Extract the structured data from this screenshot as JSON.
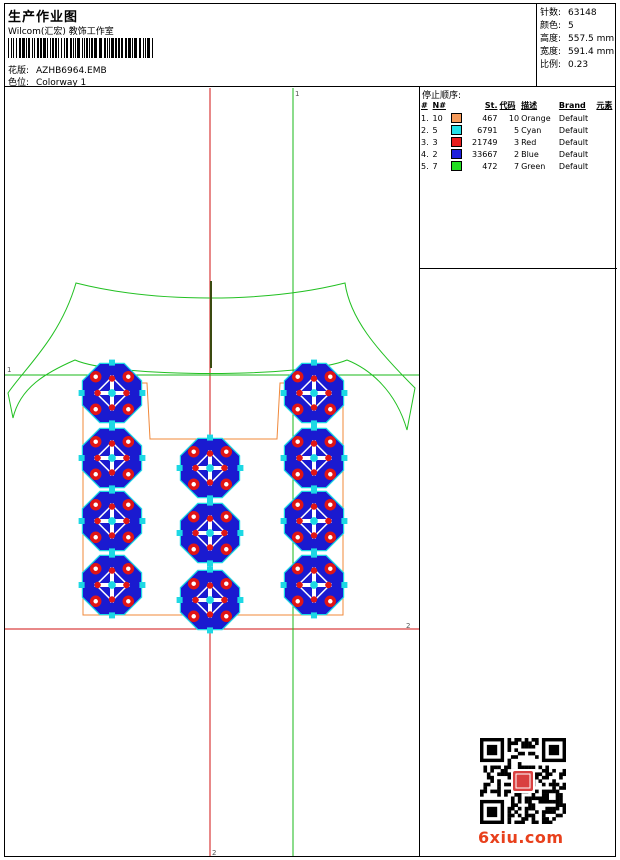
{
  "header": {
    "title": "生产作业图",
    "subtitle": "Wilcom(汇宏) 教饰工作室",
    "design_label": "花版:",
    "design_value": "AZHB6964.EMB",
    "colorway_label": "色位:",
    "colorway_value": "Colorway 1"
  },
  "stats": [
    {
      "label": "针数:",
      "value": "63148"
    },
    {
      "label": "颜色:",
      "value": "5"
    },
    {
      "label": "高度:",
      "value": "557.5 mm"
    },
    {
      "label": "宽度:",
      "value": "591.4 mm"
    },
    {
      "label": "比例:",
      "value": "0.23"
    }
  ],
  "stop_sequence": {
    "title": "停止顺序:",
    "columns": [
      "#",
      "N#",
      "St.",
      "代码",
      "描述",
      "Brand",
      "元素"
    ],
    "rows": [
      {
        "idx": "1.",
        "n": "10",
        "color": "#f59a5a",
        "stitches": "467",
        "code": "10",
        "desc": "Orange",
        "brand": "Default"
      },
      {
        "idx": "2.",
        "n": "5",
        "color": "#22e0e8",
        "stitches": "6791",
        "code": "5",
        "desc": "Cyan",
        "brand": "Default"
      },
      {
        "idx": "3.",
        "n": "3",
        "color": "#e81d1d",
        "stitches": "21749",
        "code": "3",
        "desc": "Red",
        "brand": "Default"
      },
      {
        "idx": "4.",
        "n": "2",
        "color": "#1e1edb",
        "stitches": "33667",
        "code": "2",
        "desc": "Blue",
        "brand": "Default"
      },
      {
        "idx": "5.",
        "n": "7",
        "color": "#22dd22",
        "stitches": "472",
        "code": "7",
        "desc": "Green",
        "brand": "Default"
      }
    ]
  },
  "canvas": {
    "axis_labels": [
      "1",
      "2",
      "1",
      "2"
    ],
    "colors": {
      "red_axis": "#d01010",
      "green_axis": "#1ab81a",
      "outline": "#22c022",
      "orange": "#f0883a",
      "blue": "#1a1ad0",
      "red": "#e01515",
      "cyan": "#1cd8e4"
    }
  },
  "watermark": {
    "text": "6xiu",
    "suffix": ".com"
  }
}
